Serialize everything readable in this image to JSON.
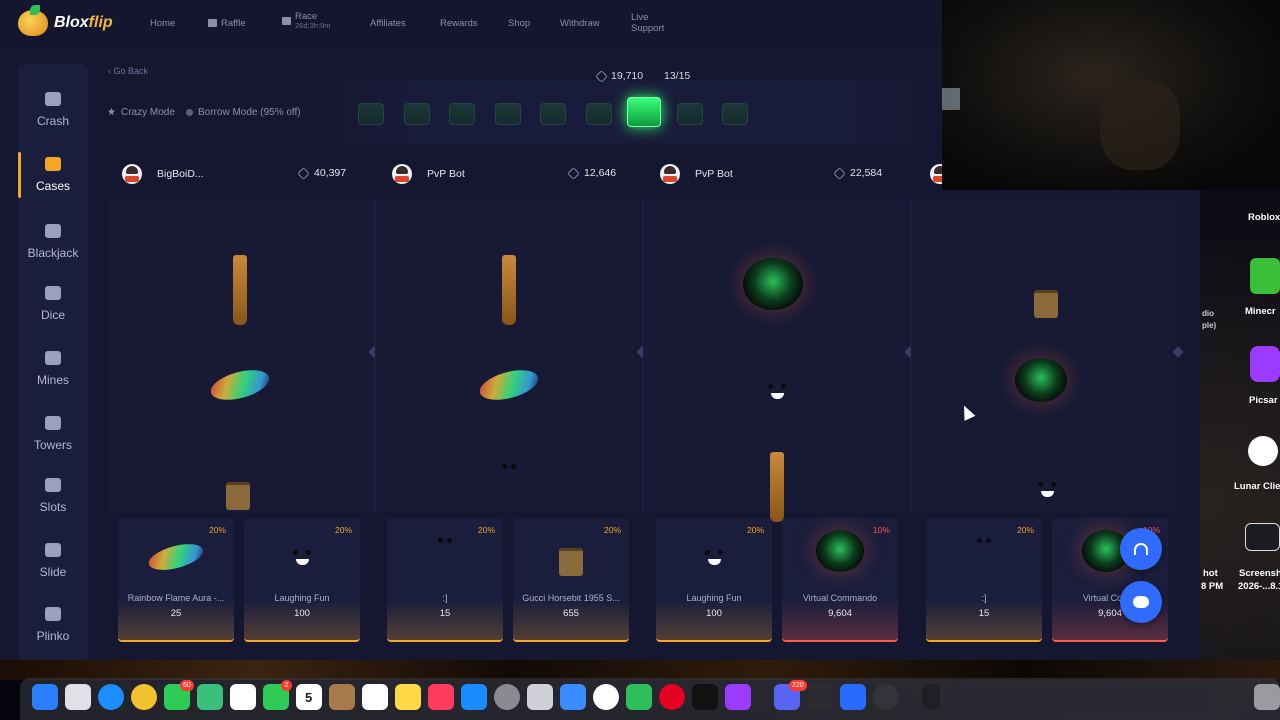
{
  "app": {
    "logo_text_main": "Blox",
    "logo_text_accent": "flip"
  },
  "nav": {
    "items": [
      {
        "label": "Home"
      },
      {
        "label": "Raffle"
      },
      {
        "label": "Race",
        "sub": "26d:3h:9m"
      },
      {
        "label": "Affiliates"
      },
      {
        "label": "Rewards"
      },
      {
        "label": "Shop"
      },
      {
        "label": "Withdraw"
      },
      {
        "label": "Live Support"
      }
    ]
  },
  "sidebar": {
    "items": [
      {
        "label": "Crash"
      },
      {
        "label": "Cases",
        "active": true
      },
      {
        "label": "Blackjack"
      },
      {
        "label": "Dice"
      },
      {
        "label": "Mines"
      },
      {
        "label": "Towers"
      },
      {
        "label": "Slots"
      },
      {
        "label": "Slide"
      },
      {
        "label": "Plinko"
      }
    ]
  },
  "battle": {
    "go_back": "Go Back",
    "total_value": "19,710",
    "round": "13/15",
    "crazy_mode": "Crazy Mode",
    "borrow_mode": "Borrow Mode (95% off)",
    "players": [
      {
        "name": "BigBoiD...",
        "value": "40,397"
      },
      {
        "name": "PvP Bot",
        "value": "12,646"
      },
      {
        "name": "PvP Bot",
        "value": "22,584"
      }
    ]
  },
  "drops": [
    {
      "name": "Rainbow Flame Aura -...",
      "value": "25",
      "pct": "20%"
    },
    {
      "name": "Laughing Fun",
      "value": "100",
      "pct": "20%"
    },
    {
      "name": ":]",
      "value": "15",
      "pct": "20%"
    },
    {
      "name": "Gucci Horsebit 1955 S...",
      "value": "655",
      "pct": "20%"
    },
    {
      "name": "Laughing Fun",
      "value": "100",
      "pct": "20%"
    },
    {
      "name": "Virtual Commando",
      "value": "9,604",
      "pct": "10%"
    },
    {
      "name": ":]",
      "value": "15",
      "pct": "20%"
    },
    {
      "name": "Virtual Comm",
      "value": "9,604",
      "pct": "10%"
    }
  ],
  "desktop": {
    "labels": [
      "Roblox",
      "Minecr",
      "Picsar",
      "Lunar Clie",
      "Screensh",
      "2026-...8.1",
      "hot",
      "8 PM",
      "PM",
      "dio",
      "ple)"
    ],
    "dock_badges": [
      "60",
      "2",
      "220"
    ],
    "calendar_month": "JUL",
    "calendar_day": "5"
  },
  "colors": {
    "accent": "#f5a623",
    "page_bg": "#151731",
    "highlight_green": "#2cff6c",
    "support_blue": "#2f6bff"
  }
}
